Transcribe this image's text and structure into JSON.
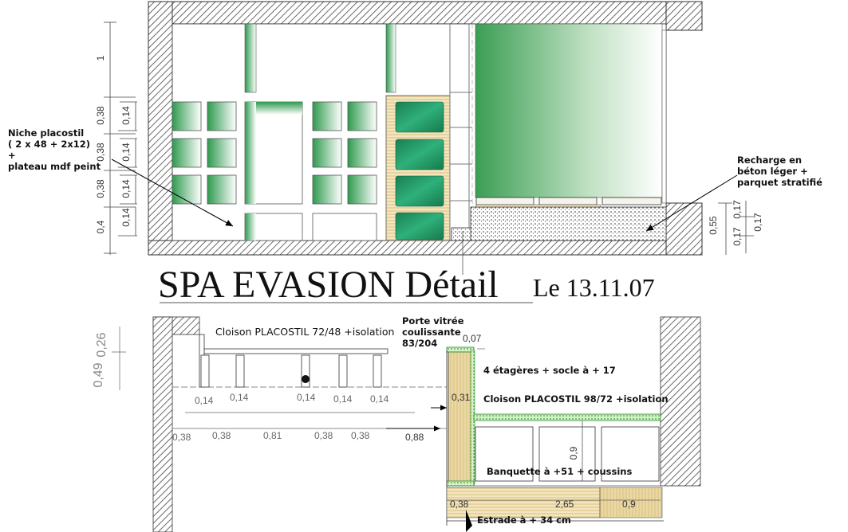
{
  "title": {
    "main": "SPA EVASION Détail",
    "date": "Le 13.11.07"
  },
  "elevation_labels": {
    "niche": "Niche placostil\n( 2 x 48 + 2x12)\n+\nplateau mdf peint",
    "recharge": "Recharge en\nbéton léger +\nparquet stratifié"
  },
  "elevation_dims_left": [
    "1",
    "0,38",
    "0,38",
    "0,38",
    "0,4"
  ],
  "elevation_dims_inner": [
    "0,14",
    "0,14",
    "0,14",
    "0,14"
  ],
  "elevation_dims_right": [
    "0,55",
    "0,17",
    "0,17",
    "0,17"
  ],
  "plan_labels": {
    "cloison_left": "Cloison PLACOSTIL 72/48 +isolation",
    "porte": "Porte vitrée\ncoulissante\n83/204",
    "etageres": "4 étagères + socle à + 17",
    "cloison_right": "Cloison PLACOSTIL 98/72 +isolation",
    "banquette": "Banquette à +51 + coussins",
    "estrade": "Estrade à + 34 cm"
  },
  "plan_dims_top": [
    "0,14",
    "0,14",
    "0,14",
    "0,14",
    "0,14"
  ],
  "plan_dims_bottom": [
    "0,38",
    "0,38",
    "0,81",
    "0,38",
    "0,38"
  ],
  "plan_dims_misc": {
    "d088": "0,88",
    "d007": "0,07",
    "d031": "0,31",
    "d09v": "0,9",
    "d038": "0,38",
    "d265": "2,65",
    "d09": "0,9",
    "d026": "0,26",
    "d049": "0,49"
  },
  "colors": {
    "hatch": "#555555",
    "green_dark": "#1f8a5a",
    "green_light": "#cfe8c4",
    "wood": "#c9a24a"
  }
}
